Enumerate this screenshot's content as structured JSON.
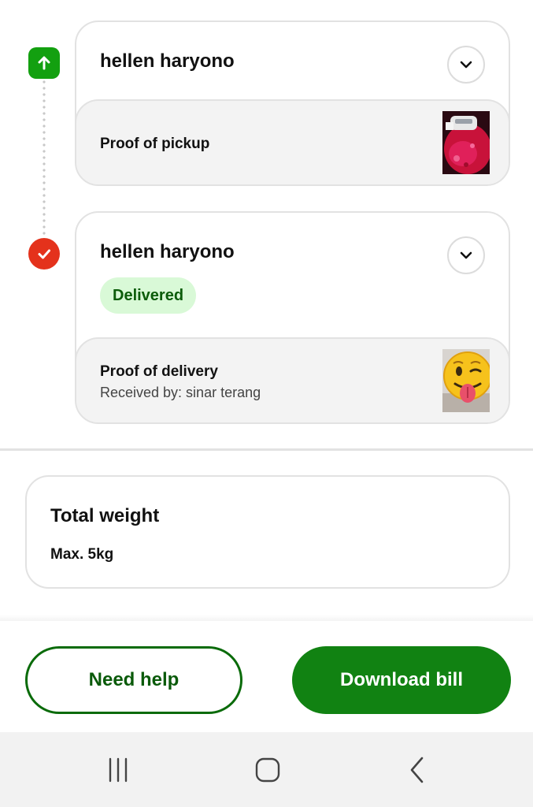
{
  "stops": [
    {
      "name": "hellen haryono",
      "type": "pickup",
      "icon": "arrow-up-icon",
      "proof_title": "Proof of pickup"
    },
    {
      "name": "hellen haryono",
      "type": "delivery",
      "icon": "checkmark-icon",
      "status": "Delivered",
      "proof_title": "Proof of delivery",
      "proof_subtitle": "Received by: sinar terang"
    }
  ],
  "weight": {
    "title": "Total weight",
    "value": "Max. 5kg"
  },
  "actions": {
    "help_label": "Need help",
    "download_label": "Download bill"
  },
  "colors": {
    "brand_green": "#118212",
    "pickup_green": "#13a010",
    "delivered_red": "#e4321c",
    "status_badge_bg": "#d9f9d7"
  }
}
